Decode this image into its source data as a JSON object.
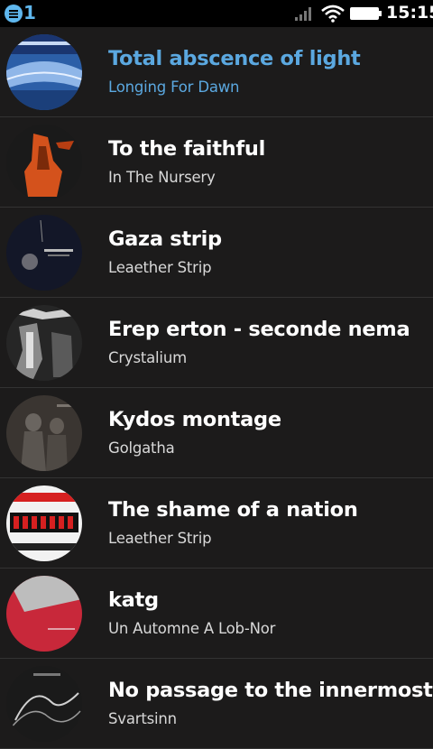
{
  "status_bar": {
    "notification_count": "1",
    "time": "15:15",
    "icons": [
      "notification-icon",
      "signal-icon",
      "wifi-icon",
      "battery-icon"
    ]
  },
  "tracks": [
    {
      "title": "Total abscence of light",
      "artist": "Longing For Dawn",
      "active": true,
      "cover_color": "#2c5fa8"
    },
    {
      "title": "To the faithful",
      "artist": "In The Nursery",
      "active": false,
      "cover_color": "#c04a1a"
    },
    {
      "title": "Gaza strip",
      "artist": "Leaether Strip",
      "active": false,
      "cover_color": "#161a2c"
    },
    {
      "title": "Erep erton - seconde nema",
      "artist": "Crystalium",
      "active": false,
      "cover_color": "#2a2a2a"
    },
    {
      "title": "Kydos montage",
      "artist": "Golgatha",
      "active": false,
      "cover_color": "#3a3531"
    },
    {
      "title": "The shame of a nation",
      "artist": "Leaether Strip",
      "active": false,
      "cover_color": "#f2f2f2"
    },
    {
      "title": "katg",
      "artist": "Un Automne A Lob-Nor",
      "active": false,
      "cover_color": "#c8283a"
    },
    {
      "title": "No passage to the innermost...",
      "artist": "Svartsinn",
      "active": false,
      "cover_color": "#1a1a1a"
    }
  ],
  "colors": {
    "background": "#1c1b1b",
    "accent": "#5ba8e0",
    "status_bar": "#000000"
  }
}
